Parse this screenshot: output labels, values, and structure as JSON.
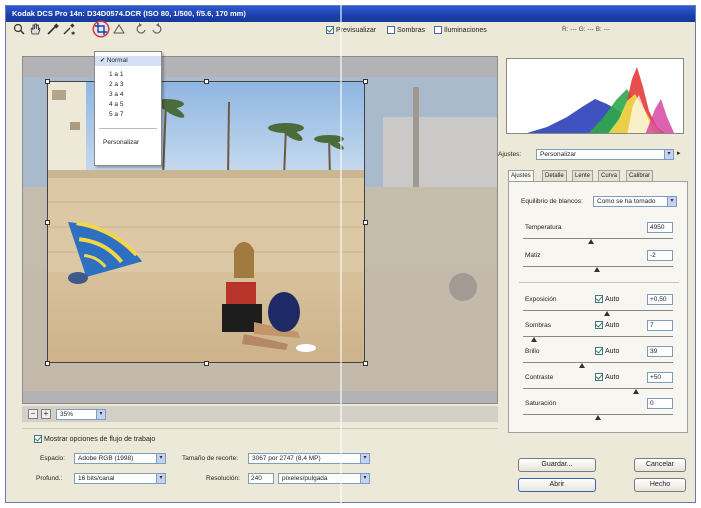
{
  "window": {
    "title": "Kodak DCS Pro 14n:  D34D0574.DCR  (ISO 80, 1/500, f/5.6, 170 mm)"
  },
  "toolbar": {
    "tools": [
      {
        "name": "zoom-tool-icon",
        "active": false
      },
      {
        "name": "hand-tool-icon",
        "active": false
      },
      {
        "name": "white-balance-tool-icon",
        "active": false
      },
      {
        "name": "color-sampler-tool-icon",
        "active": false
      },
      {
        "name": "crop-tool-icon",
        "active": true
      },
      {
        "name": "straighten-tool-icon",
        "active": false
      },
      {
        "name": "rotate-left-icon",
        "active": false
      },
      {
        "name": "rotate-right-icon",
        "active": false
      }
    ],
    "preview_label": "Previsualizar",
    "shadows_label": "Sombras",
    "highlights_label": "Iluminaciones",
    "preview_checked": true,
    "shadows_checked": false,
    "highlights_checked": false,
    "rgb_readout": "R: ---  G: ---  B: ---"
  },
  "crop_menu": {
    "items": [
      "Normal",
      "1 a 1",
      "2 a 3",
      "3 a 4",
      "4 a 5",
      "5 a 7"
    ],
    "selected": "Normal",
    "custom_label": "Personalizar"
  },
  "zoom": {
    "value": "35%"
  },
  "adjustments": {
    "settings_label": "Ajustes:",
    "settings_value": "Personalizar",
    "tabs": [
      "Ajustes",
      "Detalle",
      "Lente",
      "Curva",
      "Calibrar"
    ],
    "active_tab": "Ajustes",
    "white_balance_label": "Equilibrio de blancos:",
    "white_balance_value": "Como se ha tomado",
    "controls": [
      {
        "label": "Temperatura",
        "value": "4950",
        "auto": null,
        "level": 0.45
      },
      {
        "label": "Matiz",
        "value": "-2",
        "auto": null,
        "level": 0.49
      },
      {
        "label": "Exposición",
        "value": "+0,50",
        "auto": "Auto",
        "level": 0.56
      },
      {
        "label": "Sombras",
        "value": "7",
        "auto": "Auto",
        "level": 0.07
      },
      {
        "label": "Brillo",
        "value": "39",
        "auto": "Auto",
        "level": 0.39
      },
      {
        "label": "Contraste",
        "value": "+50",
        "auto": "Auto",
        "level": 0.75
      },
      {
        "label": "Saturación",
        "value": "0",
        "auto": null,
        "level": 0.5
      }
    ]
  },
  "workflow": {
    "show_label": "Mostrar opciones de flujo de trabajo",
    "show_checked": true,
    "space_label": "Espacio:",
    "space_value": "Adobe RGB (1998)",
    "depth_label": "Profund.:",
    "depth_value": "16 bits/canal",
    "crop_size_label": "Tamaño de recorte:",
    "crop_size_value": "3067 por 2747  (8,4 MP)",
    "resolution_label": "Resolución:",
    "resolution_value": "240",
    "resolution_unit": "píxeles/pulgada"
  },
  "buttons": {
    "save": "Guardar...",
    "cancel": "Cancelar",
    "open": "Abrir",
    "done": "Hecho"
  }
}
